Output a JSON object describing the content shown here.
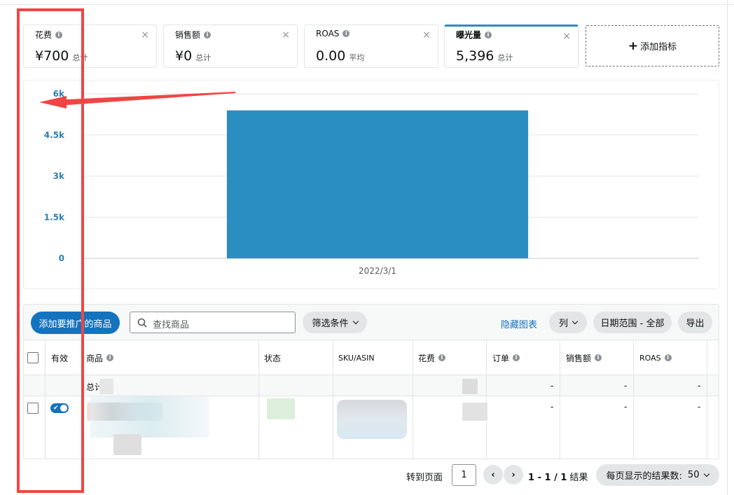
{
  "metrics": [
    {
      "title": "花费",
      "value": "¥700",
      "sub": "总计"
    },
    {
      "title": "销售额",
      "value": "¥0",
      "sub": "总计"
    },
    {
      "title": "ROAS",
      "value": "0.00",
      "sub": "平均"
    },
    {
      "title": "曝光量",
      "value": "5,396",
      "sub": "总计"
    }
  ],
  "add_metric": "添加指标",
  "close_glyph": "×",
  "info_glyph": "i",
  "chart_data": {
    "type": "bar",
    "categories": [
      "2022/3/1"
    ],
    "values": [
      5396
    ],
    "ylim": [
      0,
      6000
    ],
    "yticks": [
      "0",
      "1.5k",
      "3k",
      "4.5k",
      "6k"
    ],
    "ytick_values": [
      0,
      1500,
      3000,
      4500,
      6000
    ],
    "color": "#2a8ec0",
    "grid": true
  },
  "toolbar": {
    "add_button": "添加要推广的商品",
    "search_placeholder": "查找商品",
    "filter": "筛选条件",
    "hide_chart": "隐藏图表",
    "columns": "列",
    "date_range": "日期范围 - 全部",
    "export": "导出"
  },
  "table": {
    "headers": [
      "有效",
      "商品",
      "状态",
      "SKU/ASIN",
      "花费",
      "订单",
      "销售额",
      "ROAS"
    ],
    "total_label": "总计",
    "total_row": [
      "-",
      "-",
      "-"
    ],
    "item_row": [
      "-",
      "-",
      "-"
    ]
  },
  "pagination": {
    "goto_label": "转到页面",
    "page": "1",
    "prev": "‹",
    "next": "›",
    "range": "1 - 1 / 1",
    "result_suffix": "结果",
    "per_page_label": "每页显示的结果数:",
    "per_page_value": "50"
  },
  "colors": {
    "accent": "#1473be",
    "bar": "#2a8ec0",
    "annotation": "#f04545"
  }
}
